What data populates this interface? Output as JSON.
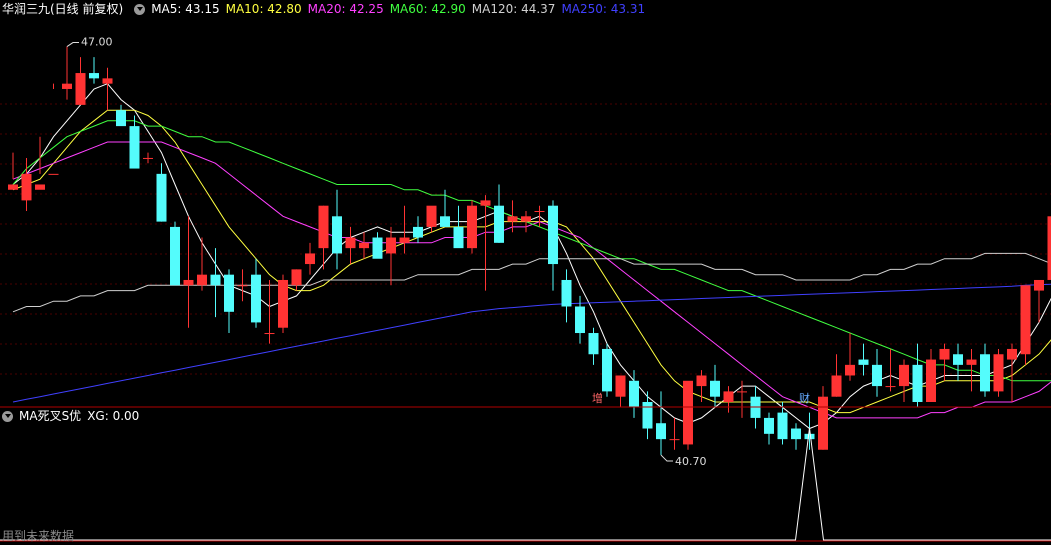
{
  "header": {
    "title": "华润三九(日线 前复权)",
    "ma": [
      {
        "label": "MA5: 43.15",
        "color": "#ffffff"
      },
      {
        "label": "MA10: 42.80",
        "color": "#ffff40"
      },
      {
        "label": "MA20: 42.25",
        "color": "#ff40ff"
      },
      {
        "label": "MA60: 42.90",
        "color": "#40ff40"
      },
      {
        "label": "MA120: 44.37",
        "color": "#d0d0d0"
      },
      {
        "label": "MA250: 43.31",
        "color": "#4040ff"
      }
    ]
  },
  "annotations": {
    "high_label": "47.00",
    "low_label": "40.70",
    "tag_zeng": "增",
    "tag_cai": "财"
  },
  "subchart": {
    "title": "MA死叉S优",
    "xg_label": "XG: 0.00"
  },
  "footer": {
    "note": "用到未来数据"
  },
  "colors": {
    "up": "#ff3333",
    "down": "#54fcfc",
    "separator": "#b00000",
    "grid": "#4a0000"
  },
  "chart_data": {
    "type": "candlestick",
    "price_range": [
      40.3,
      47.5
    ],
    "candles": [
      [
        44.3,
        45.0,
        44.4,
        44.5
      ],
      [
        44.1,
        44.9,
        44.6,
        43.9
      ],
      [
        44.3,
        45.3,
        44.4,
        44.6
      ],
      [
        44.6,
        46.3,
        44.6,
        46.2
      ],
      [
        46.2,
        47.0,
        46.3,
        46.0
      ],
      [
        45.9,
        46.8,
        46.5,
        46.3
      ],
      [
        46.5,
        46.8,
        46.4,
        46.3
      ],
      [
        46.3,
        46.6,
        46.4,
        45.8
      ],
      [
        45.8,
        45.9,
        45.5,
        45.6
      ],
      [
        45.5,
        45.7,
        44.7,
        44.7
      ],
      [
        44.9,
        45.0,
        44.9,
        44.8
      ],
      [
        44.6,
        44.8,
        43.7,
        43.7
      ],
      [
        43.6,
        43.7,
        42.5,
        42.5
      ],
      [
        42.5,
        43.8,
        42.6,
        41.7
      ],
      [
        42.5,
        43.4,
        42.7,
        42.4
      ],
      [
        42.7,
        43.2,
        42.5,
        41.9
      ],
      [
        42.7,
        42.8,
        42.0,
        41.6
      ],
      [
        42.5,
        42.8,
        42.5,
        42.2
      ],
      [
        42.7,
        43.0,
        41.8,
        41.7
      ],
      [
        41.6,
        42.6,
        41.6,
        41.4
      ],
      [
        41.7,
        42.7,
        42.6,
        41.6
      ],
      [
        42.5,
        42.8,
        42.8,
        42.4
      ],
      [
        42.9,
        43.3,
        43.1,
        42.7
      ],
      [
        43.2,
        44.0,
        44.0,
        42.8
      ],
      [
        43.8,
        44.3,
        43.1,
        42.8
      ],
      [
        43.2,
        43.6,
        43.4,
        42.9
      ],
      [
        43.2,
        43.5,
        43.3,
        43.0
      ],
      [
        43.4,
        43.5,
        43.0,
        43.2
      ],
      [
        43.1,
        43.6,
        43.4,
        42.5
      ],
      [
        43.3,
        44.0,
        43.4,
        43.1
      ],
      [
        43.6,
        43.8,
        43.4,
        43.3
      ],
      [
        43.6,
        43.9,
        44.0,
        43.5
      ],
      [
        43.8,
        44.3,
        43.6,
        43.6
      ],
      [
        43.6,
        44.0,
        43.2,
        43.3
      ],
      [
        43.2,
        44.1,
        44.0,
        43.1
      ],
      [
        44.0,
        44.2,
        44.1,
        42.4
      ],
      [
        44.0,
        44.4,
        43.3,
        43.3
      ],
      [
        43.7,
        44.1,
        43.8,
        43.5
      ],
      [
        43.7,
        43.9,
        43.8,
        43.5
      ],
      [
        43.9,
        44.0,
        43.9,
        43.6
      ],
      [
        44.0,
        44.1,
        42.9,
        42.4
      ],
      [
        42.6,
        42.8,
        42.1,
        41.8
      ],
      [
        42.1,
        42.3,
        41.6,
        41.4
      ],
      [
        41.6,
        41.7,
        41.2,
        41.0
      ],
      [
        41.3,
        41.4,
        40.5,
        40.4
      ],
      [
        40.4,
        40.8,
        40.8,
        40.2
      ],
      [
        40.7,
        40.9,
        40.2,
        40.0
      ],
      [
        40.3,
        40.5,
        39.8,
        39.6
      ],
      [
        39.9,
        40.5,
        39.6,
        39.3
      ],
      [
        39.6,
        40.0,
        39.6,
        39.4
      ],
      [
        39.5,
        40.6,
        40.7,
        39.4
      ],
      [
        40.6,
        40.9,
        40.8,
        40.3
      ],
      [
        40.7,
        41.0,
        40.4,
        40.2
      ],
      [
        40.3,
        40.6,
        40.5,
        40.1
      ],
      [
        40.5,
        40.7,
        40.5,
        40.0
      ],
      [
        40.4,
        40.6,
        40.0,
        39.8
      ],
      [
        40.0,
        40.1,
        39.7,
        39.5
      ],
      [
        40.1,
        40.3,
        39.6,
        39.5
      ],
      [
        39.8,
        39.9,
        39.6,
        39.4
      ],
      [
        39.7,
        40.1,
        39.6,
        39.4
      ],
      [
        39.4,
        40.6,
        40.4,
        39.4
      ],
      [
        40.4,
        41.2,
        40.8,
        40.4
      ],
      [
        40.8,
        41.6,
        41.0,
        40.7
      ],
      [
        41.1,
        41.4,
        41.0,
        40.8
      ],
      [
        41.0,
        41.3,
        40.6,
        40.4
      ],
      [
        40.6,
        41.3,
        40.6,
        40.5
      ],
      [
        40.6,
        41.1,
        41.0,
        40.3
      ],
      [
        41.0,
        41.4,
        40.3,
        40.2
      ],
      [
        40.3,
        41.3,
        41.1,
        40.3
      ],
      [
        41.1,
        41.4,
        41.3,
        40.7
      ],
      [
        41.2,
        41.4,
        41.0,
        40.7
      ],
      [
        41.0,
        41.3,
        41.1,
        40.5
      ],
      [
        41.2,
        41.4,
        40.5,
        40.4
      ],
      [
        40.5,
        41.3,
        41.2,
        40.4
      ],
      [
        41.1,
        41.4,
        41.3,
        40.3
      ],
      [
        41.2,
        42.3,
        42.5,
        41.0
      ],
      [
        42.4,
        42.6,
        42.6,
        41.8
      ],
      [
        42.6,
        43.4,
        43.8,
        42.5
      ]
    ],
    "ma_lines": [
      {
        "name": "MA5",
        "color": "#ffffff",
        "values": [
          44.4,
          44.6,
          44.9,
          45.3,
          45.6,
          45.9,
          46.2,
          46.3,
          46.0,
          45.8,
          45.4,
          45.0,
          44.4,
          43.8,
          43.3,
          42.9,
          42.5,
          42.4,
          42.3,
          42.1,
          42.2,
          42.3,
          42.6,
          42.9,
          43.2,
          43.4,
          43.5,
          43.6,
          43.5,
          43.5,
          43.5,
          43.6,
          43.7,
          43.7,
          43.7,
          43.8,
          43.9,
          43.8,
          43.7,
          43.8,
          43.6,
          43.1,
          42.5,
          42.0,
          41.4,
          41.0,
          40.7,
          40.4,
          40.2,
          40.0,
          39.9,
          40.0,
          40.2,
          40.4,
          40.6,
          40.6,
          40.4,
          40.2,
          40.0,
          39.8,
          39.9,
          40.1,
          40.4,
          40.6,
          40.7,
          40.8,
          40.7,
          40.6,
          40.7,
          40.8,
          40.8,
          40.8,
          40.8,
          40.9,
          41.0,
          41.4,
          41.8,
          42.3
        ]
      },
      {
        "name": "MA10",
        "color": "#ffff40",
        "values": [
          44.3,
          44.4,
          44.5,
          44.8,
          45.1,
          45.4,
          45.6,
          45.8,
          45.8,
          45.8,
          45.7,
          45.5,
          45.2,
          44.8,
          44.4,
          44.0,
          43.6,
          43.3,
          43.0,
          42.7,
          42.5,
          42.4,
          42.4,
          42.5,
          42.7,
          42.9,
          43.0,
          43.1,
          43.2,
          43.3,
          43.4,
          43.5,
          43.6,
          43.6,
          43.6,
          43.6,
          43.7,
          43.7,
          43.7,
          43.7,
          43.7,
          43.6,
          43.3,
          43.0,
          42.6,
          42.2,
          41.8,
          41.4,
          41.0,
          40.7,
          40.5,
          40.4,
          40.3,
          40.3,
          40.3,
          40.3,
          40.3,
          40.3,
          40.3,
          40.3,
          40.2,
          40.1,
          40.1,
          40.2,
          40.3,
          40.4,
          40.5,
          40.6,
          40.6,
          40.7,
          40.7,
          40.7,
          40.7,
          40.7,
          40.8,
          41.0,
          41.2,
          41.5
        ]
      },
      {
        "name": "MA20",
        "color": "#ff40ff",
        "values": [
          44.5,
          44.6,
          44.7,
          44.8,
          44.9,
          45.0,
          45.1,
          45.2,
          45.2,
          45.2,
          45.2,
          45.2,
          45.1,
          45.0,
          44.9,
          44.8,
          44.6,
          44.4,
          44.2,
          44.0,
          43.8,
          43.7,
          43.6,
          43.5,
          43.4,
          43.4,
          43.3,
          43.3,
          43.3,
          43.3,
          43.3,
          43.3,
          43.4,
          43.4,
          43.4,
          43.5,
          43.5,
          43.6,
          43.6,
          43.7,
          43.6,
          43.5,
          43.4,
          43.2,
          43.0,
          42.8,
          42.6,
          42.4,
          42.2,
          42.0,
          41.8,
          41.6,
          41.4,
          41.2,
          41.0,
          40.8,
          40.6,
          40.4,
          40.3,
          40.2,
          40.1,
          40.0,
          40.0,
          40.0,
          40.0,
          40.0,
          40.0,
          40.0,
          40.1,
          40.1,
          40.2,
          40.2,
          40.3,
          40.3,
          40.3,
          40.4,
          40.5,
          40.7
        ]
      },
      {
        "name": "MA60",
        "color": "#40ff40",
        "values": [
          44.4,
          44.7,
          44.9,
          45.1,
          45.3,
          45.4,
          45.5,
          45.6,
          45.6,
          45.6,
          45.5,
          45.5,
          45.4,
          45.3,
          45.3,
          45.2,
          45.2,
          45.1,
          45.0,
          44.9,
          44.8,
          44.7,
          44.6,
          44.5,
          44.4,
          44.4,
          44.4,
          44.4,
          44.4,
          44.3,
          44.3,
          44.2,
          44.2,
          44.1,
          44.1,
          44.0,
          43.9,
          43.8,
          43.7,
          43.6,
          43.5,
          43.4,
          43.3,
          43.2,
          43.1,
          43.0,
          43.0,
          42.9,
          42.8,
          42.8,
          42.7,
          42.6,
          42.5,
          42.4,
          42.4,
          42.3,
          42.2,
          42.1,
          42.0,
          41.9,
          41.8,
          41.7,
          41.6,
          41.5,
          41.4,
          41.3,
          41.2,
          41.1,
          41.0,
          41.0,
          40.9,
          40.9,
          40.8,
          40.8,
          40.7,
          40.7,
          40.7,
          40.7
        ]
      },
      {
        "name": "MA120",
        "color": "#d0d0d0",
        "values": [
          42.0,
          42.1,
          42.1,
          42.2,
          42.2,
          42.3,
          42.3,
          42.4,
          42.4,
          42.4,
          42.5,
          42.5,
          42.5,
          42.5,
          42.5,
          42.5,
          42.5,
          42.5,
          42.5,
          42.5,
          42.5,
          42.5,
          42.5,
          42.6,
          42.6,
          42.6,
          42.6,
          42.6,
          42.6,
          42.6,
          42.7,
          42.7,
          42.7,
          42.7,
          42.8,
          42.8,
          42.8,
          42.9,
          42.9,
          43.0,
          43.0,
          43.0,
          43.0,
          43.0,
          43.0,
          43.0,
          42.9,
          42.9,
          42.9,
          42.9,
          42.9,
          42.9,
          42.8,
          42.8,
          42.8,
          42.7,
          42.7,
          42.7,
          42.6,
          42.6,
          42.6,
          42.6,
          42.6,
          42.7,
          42.7,
          42.8,
          42.8,
          42.9,
          42.9,
          43.0,
          43.0,
          43.0,
          43.1,
          43.1,
          43.1,
          43.1,
          43.0,
          42.9
        ]
      },
      {
        "name": "MA250",
        "color": "#4040ff",
        "values": [
          40.3,
          40.35,
          40.4,
          40.45,
          40.5,
          40.55,
          40.6,
          40.65,
          40.7,
          40.75,
          40.8,
          40.85,
          40.9,
          40.95,
          41.0,
          41.05,
          41.1,
          41.15,
          41.2,
          41.25,
          41.3,
          41.35,
          41.4,
          41.45,
          41.5,
          41.55,
          41.6,
          41.65,
          41.7,
          41.75,
          41.8,
          41.85,
          41.9,
          41.95,
          42.0,
          42.03,
          42.06,
          42.08,
          42.1,
          42.12,
          42.14,
          42.15,
          42.16,
          42.17,
          42.18,
          42.19,
          42.2,
          42.21,
          42.22,
          42.23,
          42.24,
          42.25,
          42.26,
          42.27,
          42.28,
          42.29,
          42.3,
          42.31,
          42.32,
          42.33,
          42.34,
          42.35,
          42.36,
          42.37,
          42.38,
          42.39,
          42.4,
          42.41,
          42.42,
          42.43,
          42.44,
          42.45,
          42.46,
          42.47,
          42.48,
          42.5,
          42.51,
          42.52
        ]
      }
    ],
    "xg_signal": {
      "index": 59,
      "value": 1
    }
  }
}
